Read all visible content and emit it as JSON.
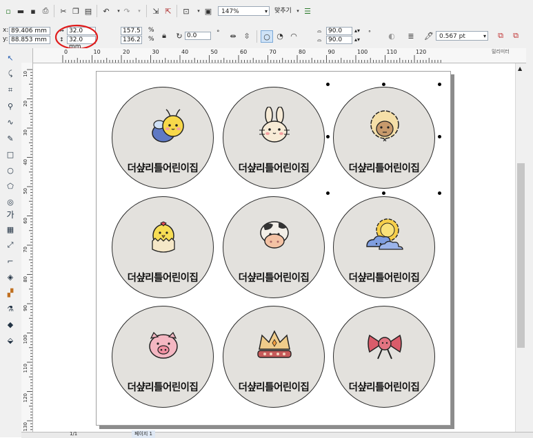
{
  "toolbar": {
    "zoom": "147%",
    "fit_label": "맞추기",
    "icons": [
      "new-icon",
      "open-icon",
      "save-icon",
      "print-icon",
      "cut-icon",
      "copy-icon",
      "paste-icon",
      "undo-icon",
      "redo-icon",
      "import-icon",
      "export-icon",
      "publish-icon",
      "app-launcher-icon"
    ]
  },
  "property_bar": {
    "x_label": "x:",
    "x_value": "89.406 mm",
    "y_label": "y:",
    "y_value": "88.853 mm",
    "width_value": "32.0 mm",
    "height_value": "32.0 mm",
    "scale_x": "157.5",
    "scale_y": "136.2",
    "percent": "%",
    "rotation": "0.0",
    "degree": "°",
    "arc_start": "90.0",
    "arc_end": "90.0",
    "outline_width": "0.567 pt"
  },
  "ruler": {
    "ticks": [
      "0",
      "10",
      "20",
      "30",
      "40",
      "50",
      "60",
      "70",
      "80",
      "90",
      "100",
      "110",
      "120"
    ],
    "unit": "밀리미터",
    "vticks": [
      "10",
      "20",
      "30",
      "40",
      "50",
      "60",
      "70",
      "80",
      "90",
      "100",
      "110",
      "120",
      "130"
    ]
  },
  "stickers": [
    {
      "text": "더샾리틀어린이집",
      "icon": "bee-icon"
    },
    {
      "text": "더샾리틀어린이집",
      "icon": "rabbit-icon"
    },
    {
      "text": "더샾리틀어린이집",
      "icon": "sheep-icon"
    },
    {
      "text": "더샾리틀어린이집",
      "icon": "chick-icon"
    },
    {
      "text": "더샾리틀어린이집",
      "icon": "cow-icon"
    },
    {
      "text": "더샾리틀어린이집",
      "icon": "sun-cloud-icon"
    },
    {
      "text": "더샾리틀어린이집",
      "icon": "pig-icon"
    },
    {
      "text": "더샾리틀어린이집",
      "icon": "crown-icon"
    },
    {
      "text": "더샾리틀어린이집",
      "icon": "bow-icon"
    }
  ],
  "status": {
    "page_count": "1/1",
    "page_tab": "페이지 1"
  },
  "annotation_color": "#e01b1b"
}
